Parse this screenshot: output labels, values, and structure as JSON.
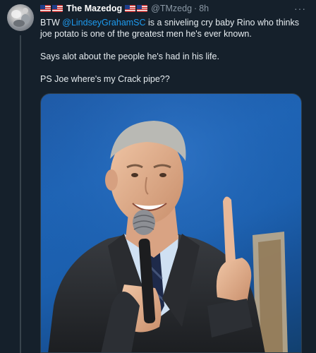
{
  "tweet": {
    "display_name": "The Mazedog",
    "handle": "@TMzedg",
    "separator": "·",
    "time": "8h",
    "more": "···",
    "text_before_mention": "BTW ",
    "mention": "@LindseyGrahamSC",
    "text_after_mention": "  is a sniveling cry baby Rino who thinks joe potato is one of the greatest men he's ever known.",
    "paragraph_2": "Says alot about the people he's had in his life.",
    "paragraph_3": "PS Joe where's my Crack pipe??"
  },
  "colors": {
    "background": "#15202b",
    "link": "#1d9bf0",
    "muted": "#8b98a5",
    "photo_backdrop": "#1e63b4"
  }
}
